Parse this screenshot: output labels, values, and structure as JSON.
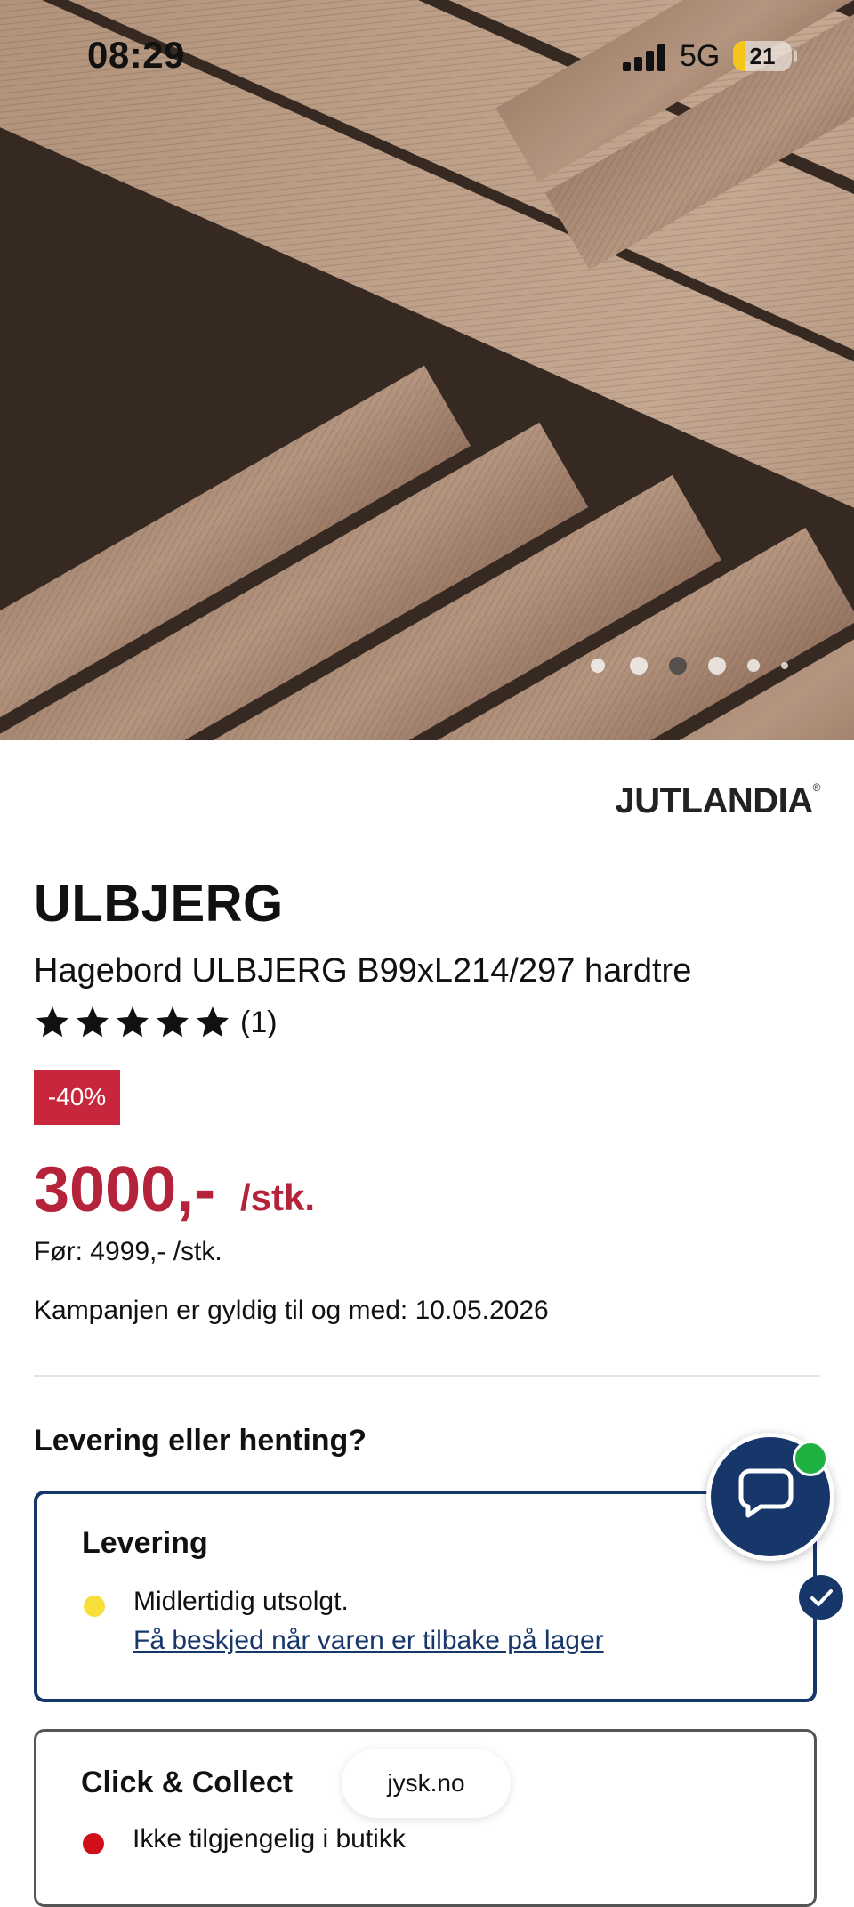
{
  "status_bar": {
    "time": "08:29",
    "network": "5G",
    "battery": "21",
    "battery_level": 0.21
  },
  "gallery": {
    "image_count": 6,
    "active_index": 2
  },
  "product": {
    "brand": "JUTLANDIA",
    "brand_mark": "®",
    "name": "ULBJERG",
    "description": "Hagebord ULBJERG B99xL214/297 hardtre",
    "rating_stars": 5,
    "review_count": "(1)",
    "discount_badge": "-40%",
    "price": "3000,-",
    "price_unit": "/stk.",
    "before_price": "Før: 4999,- /stk.",
    "campaign_valid": "Kampanjen er gyldig til og med: 10.05.2026"
  },
  "delivery": {
    "question": "Levering eller henting?",
    "options": [
      {
        "title": "Levering",
        "status": "Midlertidig utsolgt.",
        "link": "Få beskjed når varen er tilbake på lager",
        "status_color": "#f7de3a",
        "selected": true
      },
      {
        "title": "Click & Collect",
        "status": "Ikke tilgjengelig i butikk",
        "status_color": "#d10f1b",
        "selected": false
      }
    ]
  },
  "browser": {
    "url": "jysk.no"
  },
  "colors": {
    "accent": "#17376b",
    "sale": "#b5233a",
    "badge": "#c8263d",
    "online": "#1fb141"
  },
  "icons": {
    "chat": "chat-bubble-icon",
    "check": "check-icon",
    "star": "star-icon"
  }
}
